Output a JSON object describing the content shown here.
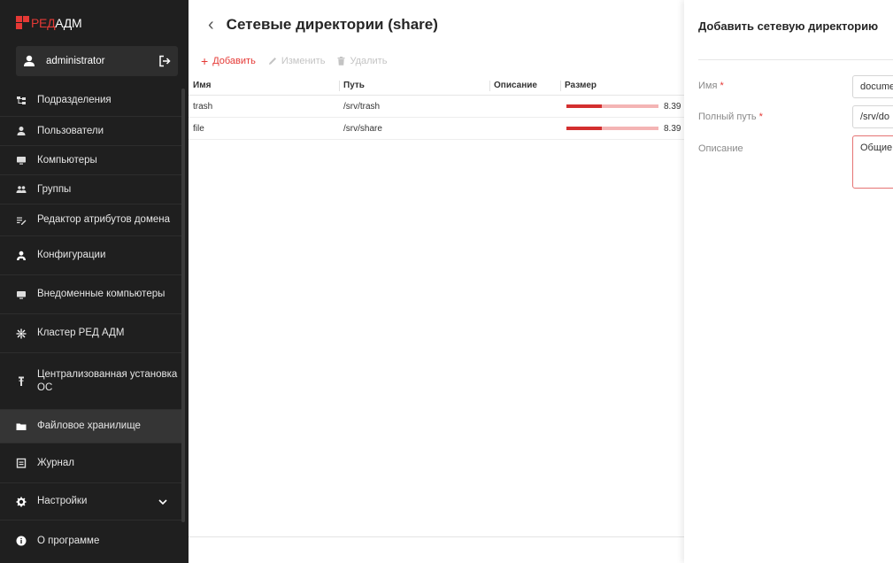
{
  "app": {
    "logo_red": "РЕД",
    "logo_white": "АДМ"
  },
  "user": {
    "name": "administrator",
    "icon": "user-icon",
    "logout_icon": "logout-icon"
  },
  "sidebar": {
    "items": [
      {
        "label": "Подразделения",
        "icon": "org-tree-icon"
      },
      {
        "label": "Пользователи",
        "icon": "person-icon"
      },
      {
        "label": "Компьютеры",
        "icon": "monitor-icon"
      },
      {
        "label": "Группы",
        "icon": "group-icon"
      },
      {
        "label": "Редактор атрибутов домена",
        "icon": "edit-list-icon"
      },
      {
        "label": "Конфигурации",
        "icon": "config-icon"
      },
      {
        "label": "Внедоменные компьютеры",
        "icon": "monitor-icon"
      },
      {
        "label": "Кластер РЕД АДМ",
        "icon": "cluster-icon"
      },
      {
        "label": "Централизованная установка ОС",
        "icon": "install-icon"
      },
      {
        "label": "Файловое хранилище",
        "icon": "folder-icon",
        "active": true
      },
      {
        "label": "Журнал",
        "icon": "journal-icon"
      },
      {
        "label": "Настройки",
        "icon": "gear-icon",
        "expandable": true
      },
      {
        "label": "О программе",
        "icon": "info-icon"
      }
    ]
  },
  "page": {
    "title": "Сетевые директории (share)",
    "back_icon": "back-arrow-icon"
  },
  "toolbar": {
    "add_label": "Добавить",
    "edit_label": "Изменить",
    "delete_label": "Удалить"
  },
  "table": {
    "columns": [
      "Имя",
      "Путь",
      "Описание",
      "Размер"
    ],
    "rows": [
      {
        "name": "trash",
        "path": "/srv/trash",
        "description": "",
        "size_text": "8.39",
        "usage_fraction": 0.38
      },
      {
        "name": "file",
        "path": "/srv/share",
        "description": "",
        "size_text": "8.39",
        "usage_fraction": 0.38
      }
    ]
  },
  "panel": {
    "title": "Добавить сетевую директорию",
    "fields": {
      "name_label": "Имя",
      "name_value": "docume",
      "path_label": "Полный путь",
      "path_value": "/srv/do",
      "desc_label": "Описание",
      "desc_value": "Общие"
    },
    "required_mark": "*"
  },
  "colors": {
    "accent": "#e53935",
    "sidebar_bg": "#1f1f1f",
    "bar_fill": "#d32f2f",
    "bar_track": "#f4b4b4"
  }
}
